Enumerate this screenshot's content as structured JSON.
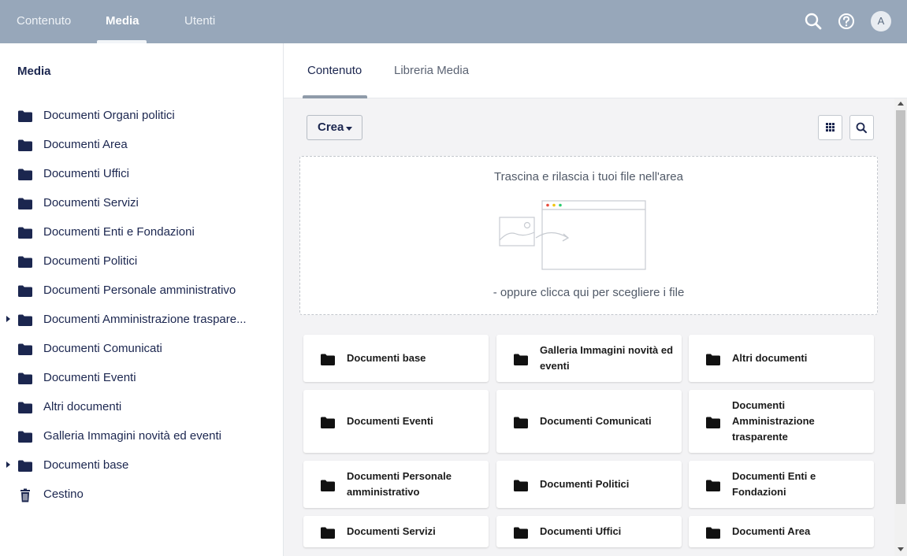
{
  "topnav": {
    "items": [
      {
        "label": "Contenuto",
        "active": false
      },
      {
        "label": "Media",
        "active": true
      },
      {
        "label": "Utenti",
        "active": false
      }
    ],
    "search_icon": "search-icon",
    "help_icon": "help-icon",
    "avatar_initial": "A"
  },
  "sidebar": {
    "title": "Media",
    "items": [
      {
        "label": "Documenti Organi politici",
        "icon": "folder-icon",
        "has_children": false
      },
      {
        "label": "Documenti Area",
        "icon": "folder-icon",
        "has_children": false
      },
      {
        "label": "Documenti Uffici",
        "icon": "folder-icon",
        "has_children": false
      },
      {
        "label": "Documenti Servizi",
        "icon": "folder-icon",
        "has_children": false
      },
      {
        "label": "Documenti Enti e Fondazioni",
        "icon": "folder-icon",
        "has_children": false
      },
      {
        "label": "Documenti Politici",
        "icon": "folder-icon",
        "has_children": false
      },
      {
        "label": "Documenti Personale amministrativo",
        "icon": "folder-icon",
        "has_children": false
      },
      {
        "label": "Documenti Amministrazione traspare...",
        "icon": "folder-icon",
        "has_children": true
      },
      {
        "label": "Documenti Comunicati",
        "icon": "folder-icon",
        "has_children": false
      },
      {
        "label": "Documenti Eventi",
        "icon": "folder-icon",
        "has_children": false
      },
      {
        "label": "Altri documenti",
        "icon": "folder-icon",
        "has_children": false
      },
      {
        "label": "Galleria Immagini novità ed eventi",
        "icon": "folder-icon",
        "has_children": false
      },
      {
        "label": "Documenti base",
        "icon": "folder-icon",
        "has_children": true
      },
      {
        "label": "Cestino",
        "icon": "trash-icon",
        "has_children": false
      }
    ]
  },
  "main": {
    "tabs": [
      {
        "label": "Contenuto",
        "active": true
      },
      {
        "label": "Libreria Media",
        "active": false
      }
    ],
    "create_button_label": "Crea",
    "dropzone": {
      "title": "Trascina e rilascia i tuoi file nell'area",
      "subtitle": "- oppure clicca qui per scegliere i file"
    },
    "folders": [
      {
        "label": "Documenti base"
      },
      {
        "label": "Galleria Immagini novità ed eventi"
      },
      {
        "label": "Altri documenti"
      },
      {
        "label": "Documenti Eventi"
      },
      {
        "label": "Documenti Comunicati"
      },
      {
        "label": "Documenti Amministrazione trasparente"
      },
      {
        "label": "Documenti Personale amministrativo"
      },
      {
        "label": "Documenti Politici"
      },
      {
        "label": "Documenti Enti e Fondazioni"
      },
      {
        "label": "Documenti Servizi"
      },
      {
        "label": "Documenti Uffici"
      },
      {
        "label": "Documenti Area"
      }
    ]
  },
  "colors": {
    "topbar": "#97a7ba",
    "navy": "#1b264f"
  }
}
